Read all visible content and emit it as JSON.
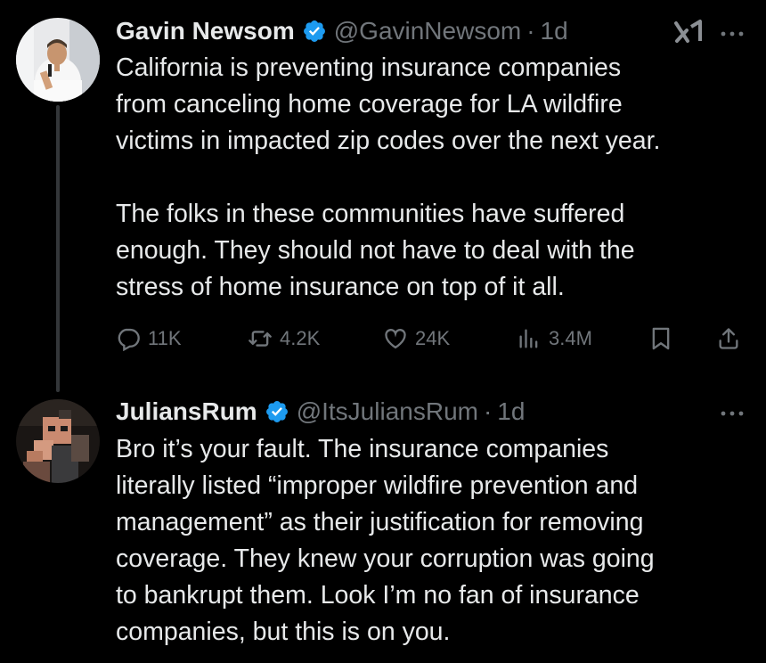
{
  "tweets": [
    {
      "name": "Gavin Newsom",
      "handle": "@GavinNewsom",
      "separator": "·",
      "time": "1d",
      "text": "California is preventing insurance companies\nfrom canceling home coverage for LA wildfire\nvictims in impacted zip codes over the next year.\n\nThe folks in these communities have suffered\nenough. They should not have to deal with the\nstress of home insurance on top of it all.",
      "actions": {
        "replies": "11K",
        "reposts": "4.2K",
        "likes": "24K",
        "views": "3.4M"
      }
    },
    {
      "name": "JuliansRum",
      "handle": "@ItsJuliansRum",
      "separator": "·",
      "time": "1d",
      "text": "Bro it’s your fault. The insurance companies\nliterally listed “improper wildfire prevention and\nmanagement” as their justification for removing\ncoverage. They knew your corruption was going\nto bankrupt them. Look I’m no fan of insurance\ncompanies, but this is on you."
    }
  ],
  "colors": {
    "background": "#000000",
    "text": "#e7e9ea",
    "secondary": "#71767b",
    "verified": "#1d9bf0",
    "thread_line": "#333639"
  },
  "icons": [
    "verified-badge-icon",
    "grok-icon",
    "more-icon",
    "reply-icon",
    "repost-icon",
    "like-icon",
    "views-icon",
    "bookmark-icon",
    "share-icon"
  ]
}
